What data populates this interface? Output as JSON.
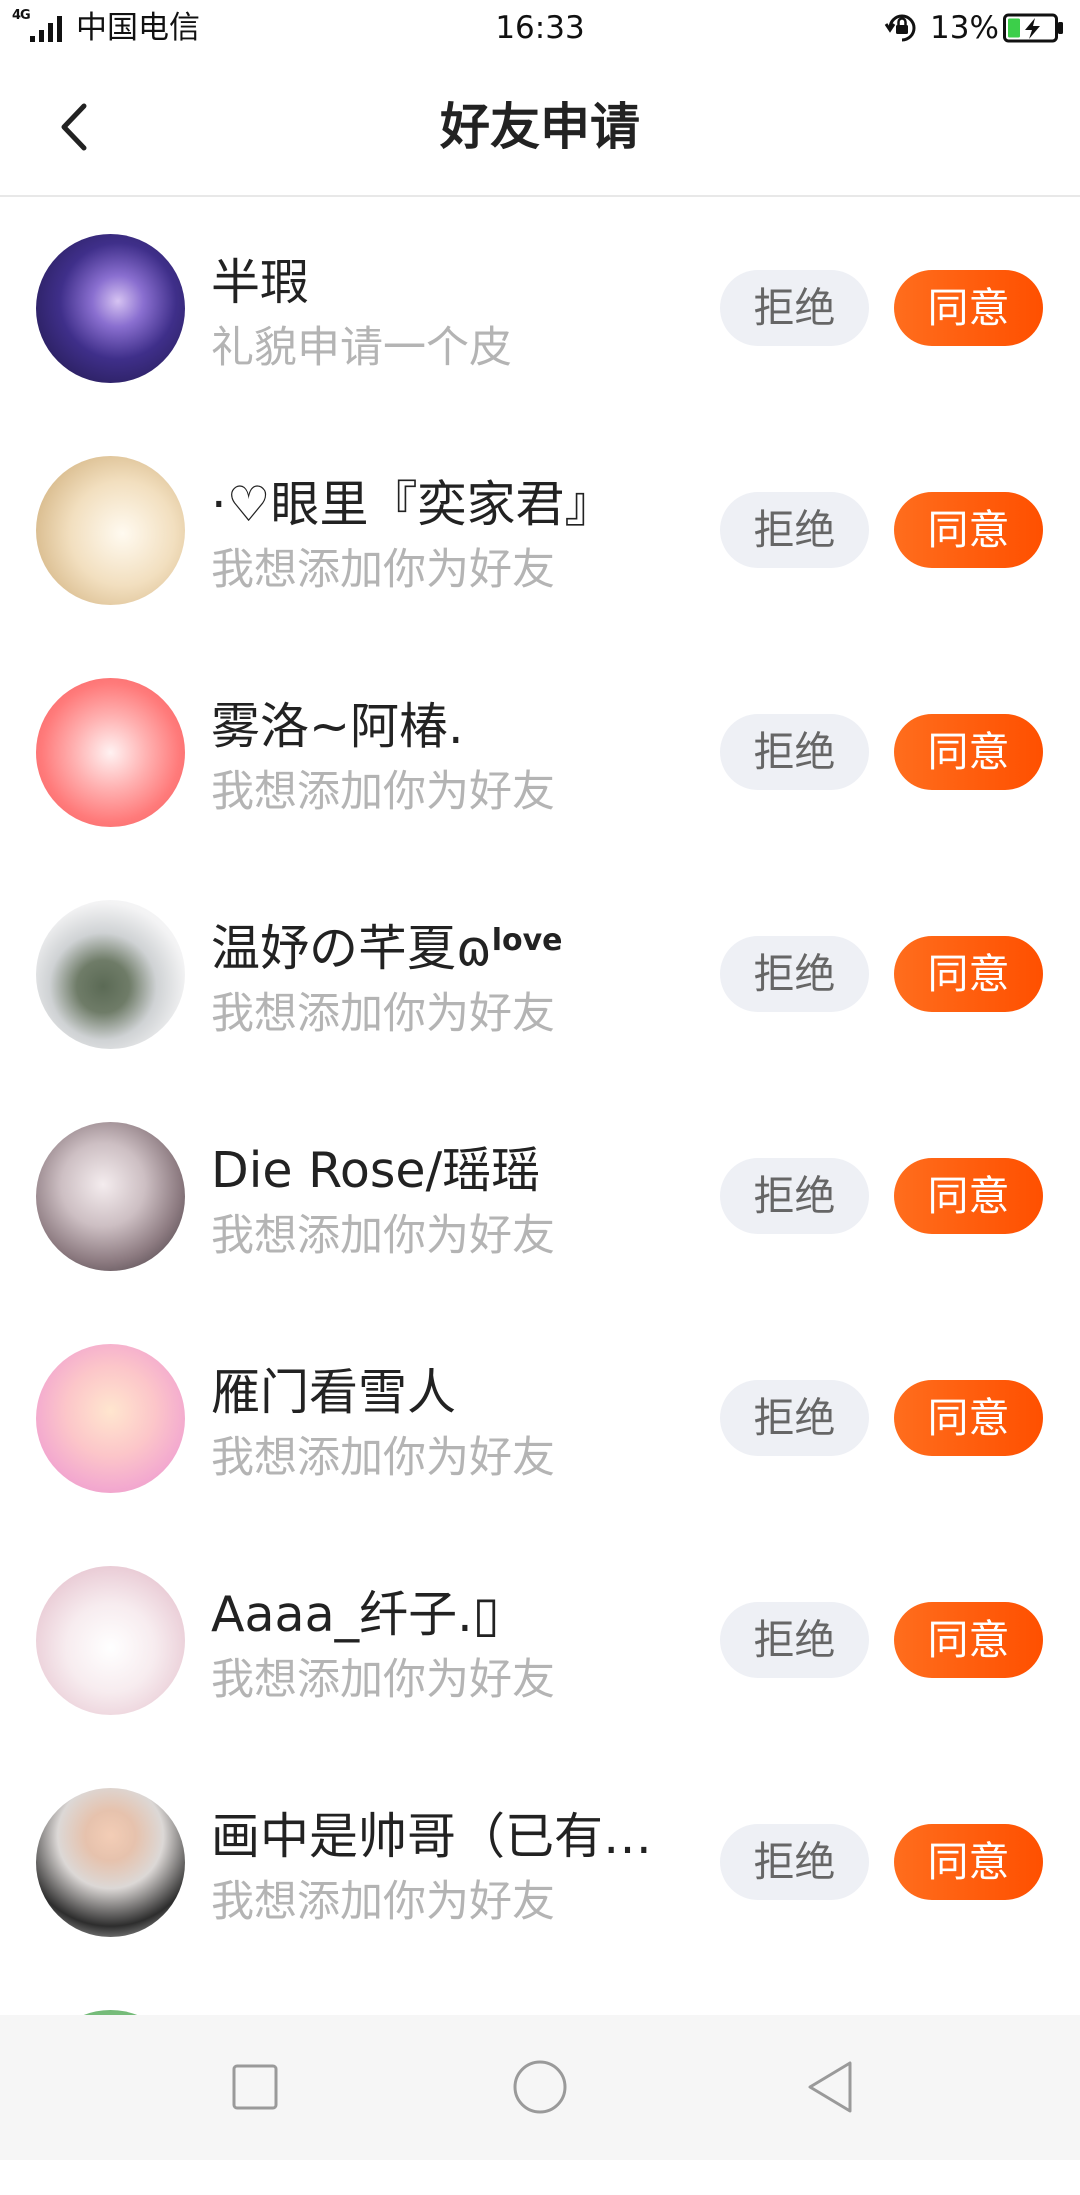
{
  "status_bar": {
    "network": "4G",
    "carrier": "中国电信",
    "time": "16:33",
    "battery": "13%"
  },
  "header": {
    "title": "好友申请",
    "back_icon": "chevron-left-icon"
  },
  "buttons": {
    "reject": "拒绝",
    "accept": "同意"
  },
  "requests": [
    {
      "name": "半瑕",
      "message": "礼貌申请一个皮"
    },
    {
      "name": "·♡眼里『奕家君』",
      "message": "我想添加你为好友"
    },
    {
      "name": "雾洛~阿椿.",
      "message": "我想添加你为好友"
    },
    {
      "name": "温妤の芊夏ɷ",
      "name_sup": "love",
      "message": "我想添加你为好友"
    },
    {
      "name": "Die Rose/瑶瑶",
      "message": "我想添加你为好友"
    },
    {
      "name": "雁门看雪人",
      "message": "我想添加你为好友"
    },
    {
      "name": "Aaaa_纤子.▯",
      "message": "我想添加你为好友"
    },
    {
      "name": "画中是帅哥（已有…",
      "message": "我想添加你为好友"
    }
  ],
  "colors": {
    "accent": "#ff5a10",
    "reject_bg": "#eef0f5",
    "battery_charging": "#3ccf4a"
  },
  "nav_bar": {
    "icons": [
      "recent-apps-icon",
      "home-icon",
      "back-icon"
    ]
  }
}
